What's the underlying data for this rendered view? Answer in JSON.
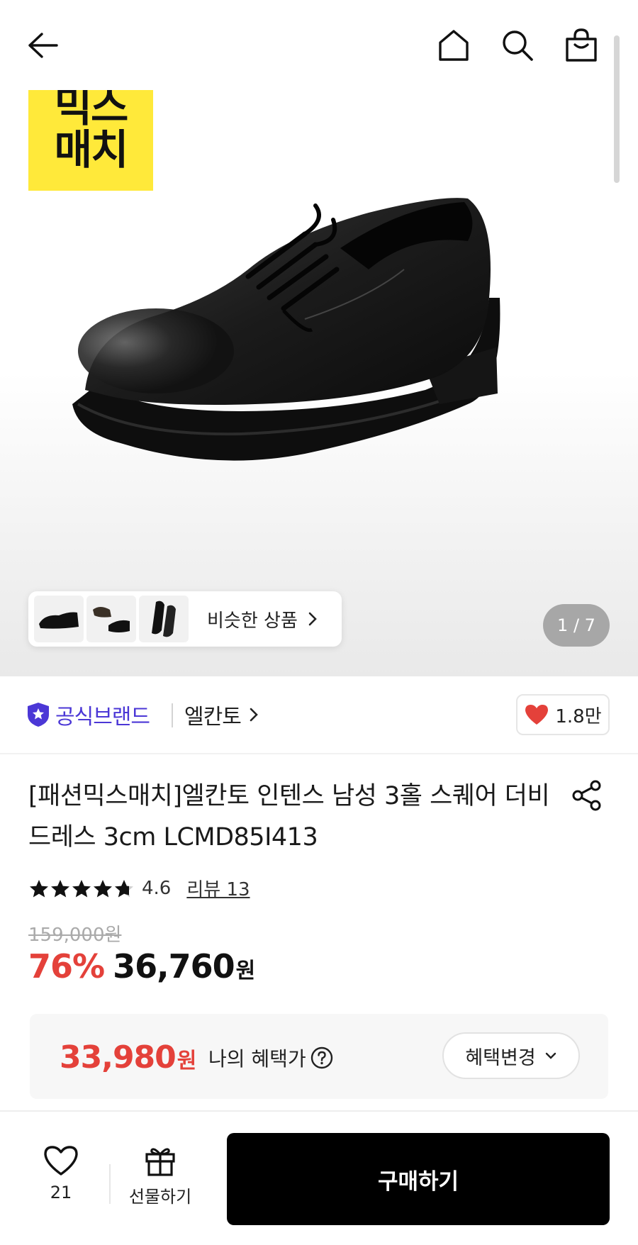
{
  "header": {
    "back_icon": "arrow-left-icon",
    "home_icon": "home-icon",
    "search_icon": "search-icon",
    "cart_icon": "shopping-bag-icon"
  },
  "gallery": {
    "badge_line1": "믹스",
    "badge_line2": "매치",
    "badge_color": "#ffe93a",
    "similar_label": "비슷한 상품",
    "pager": "1 / 7"
  },
  "brand": {
    "official_label": "공식브랜드",
    "official_color": "#4b37d6",
    "brand_name": "엘칸토",
    "like_count": "1.8만"
  },
  "product": {
    "title": "[패션믹스매치]엘칸토 인텐스 남성 3홀 스퀘어 더비 드레스 3cm LCMD85I413",
    "rating": 4.6,
    "rating_text": "4.6",
    "review_link": "리뷰 13",
    "original_price": "159,000원",
    "discount": "76%",
    "sale_price": "36,760",
    "currency": "원",
    "accent_color": "#e4413a"
  },
  "benefit": {
    "price": "33,980",
    "currency": "원",
    "label": "나의 혜택가",
    "change_button": "혜택변경"
  },
  "bottom_bar": {
    "wishlist_count": "21",
    "gift_label": "선물하기",
    "buy_button": "구매하기"
  }
}
